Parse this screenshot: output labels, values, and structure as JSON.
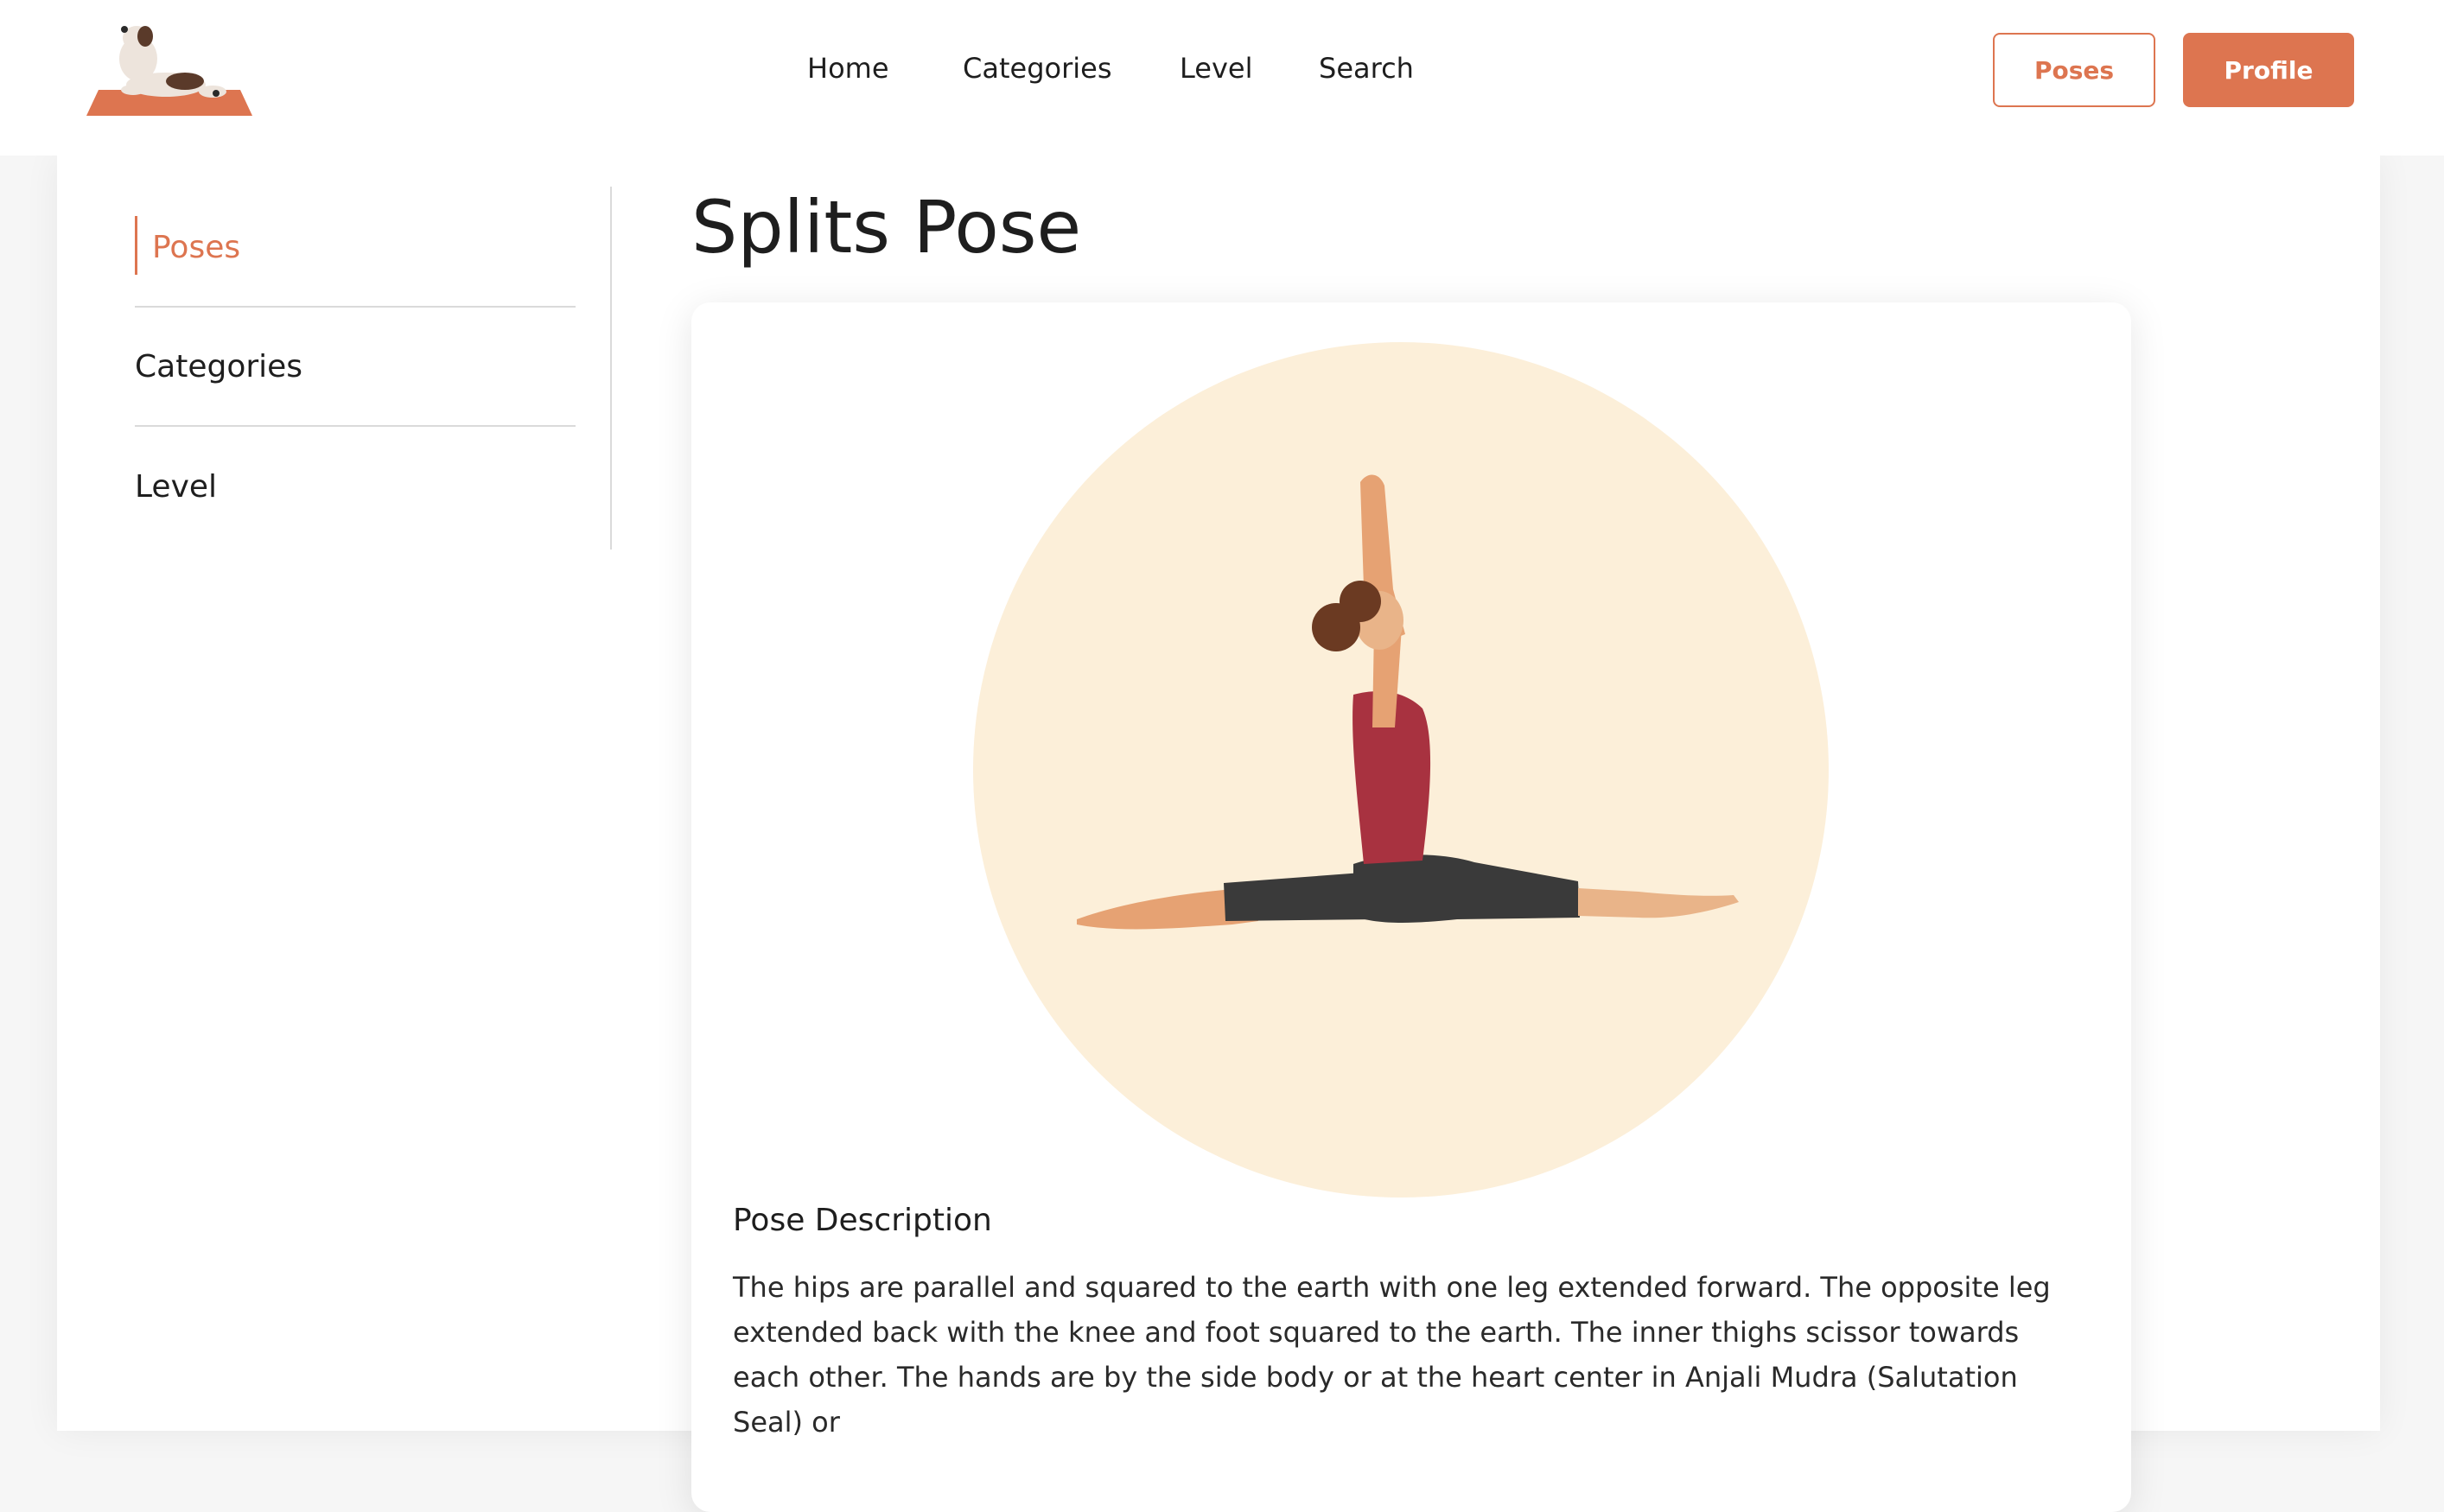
{
  "header": {
    "logo_icon": "puppy-on-yoga-mat-icon",
    "nav": [
      "Home",
      "Categories",
      "Level",
      "Search"
    ],
    "poses_button": "Poses",
    "profile_button": "Profile",
    "accent_color": "#dd7550"
  },
  "sidebar": {
    "items": [
      {
        "label": "Poses",
        "active": true
      },
      {
        "label": "Categories",
        "active": false
      },
      {
        "label": "Level",
        "active": false
      }
    ]
  },
  "main": {
    "title": "Splits Pose",
    "illustration_icon": "splits-pose-illustration",
    "description_heading": "Pose Description",
    "description": "The hips are parallel and squared to the earth with one leg extended forward. The opposite leg extended back with the knee and foot squared to the earth. The inner thighs scissor towards each other. The hands are by the side body or at the heart center in Anjali Mudra (Salutation Seal) or"
  }
}
